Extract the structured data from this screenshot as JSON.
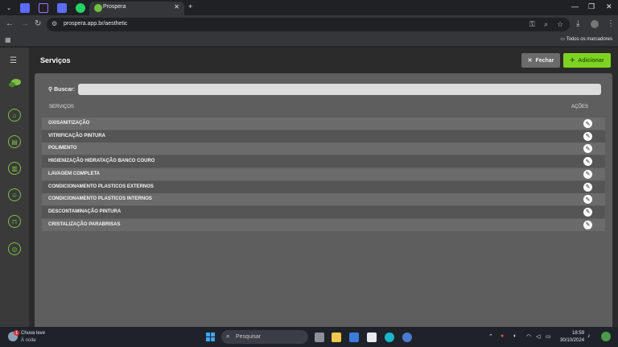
{
  "browser": {
    "active_tab_title": "Prospera",
    "url": "prospera.app.br/aesthetic",
    "bookmarks_folder": "Todos os marcadores"
  },
  "app": {
    "page_title": "Serviços",
    "close_label": "Fechar",
    "add_label": "Adicionar",
    "search_label": "Buscar:",
    "search_value": "",
    "accent_color": "#7ed321",
    "table": {
      "headers": [
        "SERVIÇOS",
        "AÇÕES"
      ],
      "rows": [
        "OXISANITIZAÇÃO",
        "VITRIFICAÇÃO PINTURA",
        "POLIMENTO",
        "HIGIENIZAÇÃO HIDRATAÇÃO BANCO COURO",
        "LAVAGEM COMPLETA",
        "CONDICIONAMENTO PLASTICOS EXTERNOS",
        "CONDICIONAMENTO PLASTICOS INTERNOS",
        "DESCONTAMINAÇÃO PINTURA",
        "CRISTALIZAÇÃO PARABRISAS"
      ]
    }
  },
  "taskbar": {
    "weather_title": "Chuva leve",
    "weather_sub": "À noite",
    "weather_badge": "1",
    "search_placeholder": "Pesquisar",
    "time": "18:59",
    "date": "30/10/2024"
  }
}
